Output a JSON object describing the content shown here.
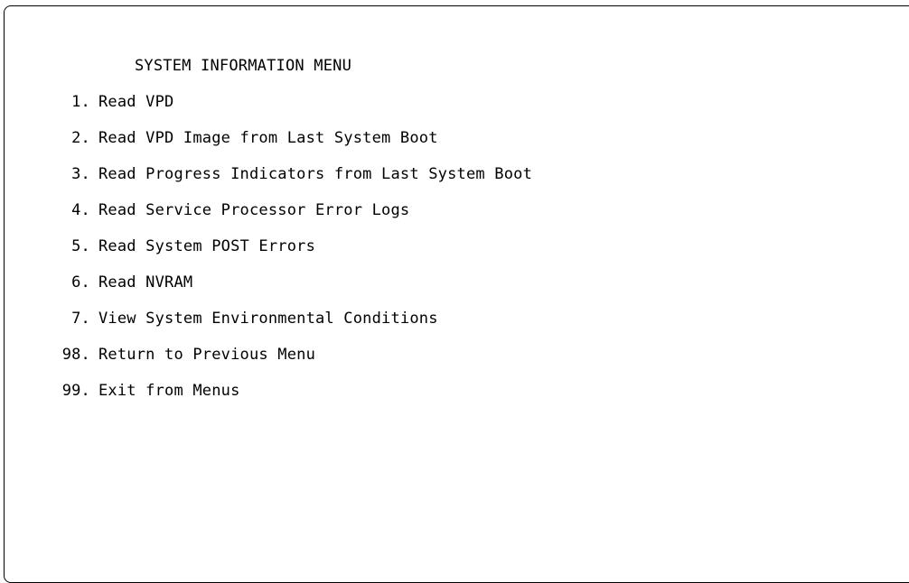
{
  "menu": {
    "title": "SYSTEM INFORMATION MENU",
    "items": [
      {
        "number": "1.",
        "label": "Read VPD"
      },
      {
        "number": "2.",
        "label": "Read VPD Image from Last System Boot"
      },
      {
        "number": "3.",
        "label": "Read Progress Indicators from Last System Boot"
      },
      {
        "number": "4.",
        "label": "Read Service Processor Error Logs"
      },
      {
        "number": "5.",
        "label": "Read System POST Errors"
      },
      {
        "number": "6.",
        "label": "Read NVRAM"
      },
      {
        "number": "7.",
        "label": "View System Environmental Conditions"
      },
      {
        "number": "98.",
        "label": "Return to Previous Menu"
      },
      {
        "number": "99.",
        "label": "Exit from Menus"
      }
    ]
  }
}
